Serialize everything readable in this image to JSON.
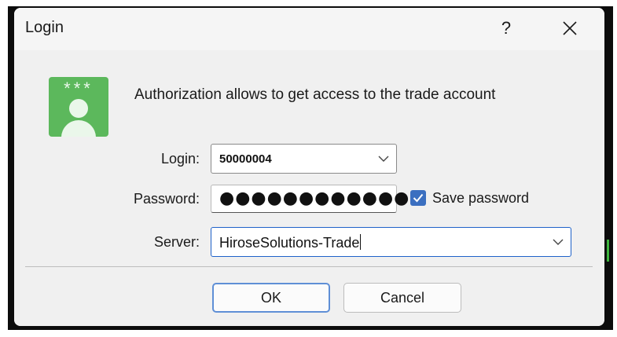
{
  "dialog": {
    "title": "Login",
    "help_label": "?",
    "close_icon": "close-icon"
  },
  "header": {
    "icon": "user-password-icon",
    "icon_stars": "***",
    "message": "Authorization allows to get access to the trade account"
  },
  "form": {
    "login": {
      "label": "Login:",
      "value": "50000004"
    },
    "password": {
      "label": "Password:",
      "masked_value": "●●●●●●●●●●●●"
    },
    "save_password": {
      "label": "Save password",
      "checked": true
    },
    "server": {
      "label": "Server:",
      "value": "HiroseSolutions-Trade"
    }
  },
  "buttons": {
    "ok": "OK",
    "cancel": "Cancel"
  },
  "colors": {
    "accent": "#3b6fc0",
    "icon_green": "#5cb85c",
    "focus_border": "#1f62c9"
  }
}
